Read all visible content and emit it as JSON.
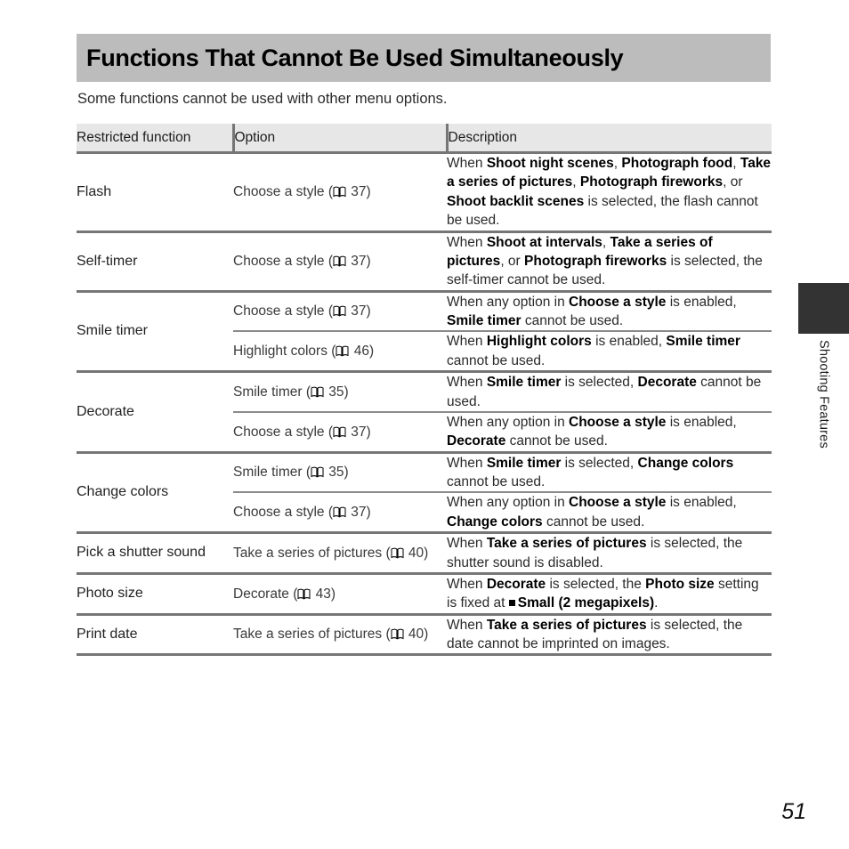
{
  "page": {
    "title": "Functions That Cannot Be Used Simultaneously",
    "intro": "Some functions cannot be used with other menu options.",
    "page_number": "51",
    "side_tab_label": "Shooting Features",
    "colors": {
      "title_bar_bg": "#bcbcbc",
      "header_row_bg": "#e7e7e7",
      "border": "#767676",
      "side_tab_bg": "#333333",
      "text": "#2a2a2a"
    }
  },
  "table": {
    "headers": [
      "Restricted function",
      "Option",
      "Description"
    ],
    "rows": [
      {
        "function": "Flash",
        "entries": [
          {
            "option_text": "Choose a style (",
            "option_icon": "book-icon",
            "option_page": "37)",
            "description_runs": [
              {
                "t": "When ",
                "b": false
              },
              {
                "t": "Shoot night scenes",
                "b": true
              },
              {
                "t": ", ",
                "b": false
              },
              {
                "t": "Photograph food",
                "b": true
              },
              {
                "t": ", ",
                "b": false
              },
              {
                "t": "Take a series of pictures",
                "b": true
              },
              {
                "t": ", ",
                "b": false
              },
              {
                "t": "Photograph fireworks",
                "b": true
              },
              {
                "t": ", or ",
                "b": false
              },
              {
                "t": "Shoot backlit scenes",
                "b": true
              },
              {
                "t": " is selected, the flash cannot be used.",
                "b": false
              }
            ]
          }
        ]
      },
      {
        "function": "Self-timer",
        "entries": [
          {
            "option_text": "Choose a style (",
            "option_icon": "book-icon",
            "option_page": "37)",
            "description_runs": [
              {
                "t": "When ",
                "b": false
              },
              {
                "t": "Shoot at intervals",
                "b": true
              },
              {
                "t": ", ",
                "b": false
              },
              {
                "t": "Take a series of pictures",
                "b": true
              },
              {
                "t": ", or ",
                "b": false
              },
              {
                "t": "Photograph fireworks",
                "b": true
              },
              {
                "t": " is selected, the self-timer cannot be used.",
                "b": false
              }
            ]
          }
        ]
      },
      {
        "function": "Smile timer",
        "entries": [
          {
            "option_text": "Choose a style (",
            "option_icon": "book-icon",
            "option_page": "37)",
            "description_runs": [
              {
                "t": "When any option in ",
                "b": false
              },
              {
                "t": "Choose a style",
                "b": true
              },
              {
                "t": " is enabled, ",
                "b": false
              },
              {
                "t": "Smile timer",
                "b": true
              },
              {
                "t": " cannot be used.",
                "b": false
              }
            ]
          },
          {
            "option_text": "Highlight colors (",
            "option_icon": "book-icon",
            "option_page": "46)",
            "description_runs": [
              {
                "t": "When ",
                "b": false
              },
              {
                "t": "Highlight colors",
                "b": true
              },
              {
                "t": " is enabled, ",
                "b": false
              },
              {
                "t": "Smile timer",
                "b": true
              },
              {
                "t": " cannot be used.",
                "b": false
              }
            ]
          }
        ]
      },
      {
        "function": "Decorate",
        "entries": [
          {
            "option_text": "Smile timer (",
            "option_icon": "book-icon",
            "option_page": "35)",
            "description_runs": [
              {
                "t": "When ",
                "b": false
              },
              {
                "t": "Smile timer",
                "b": true
              },
              {
                "t": " is selected, ",
                "b": false
              },
              {
                "t": "Decorate",
                "b": true
              },
              {
                "t": " cannot be used.",
                "b": false
              }
            ]
          },
          {
            "option_text": "Choose a style (",
            "option_icon": "book-icon",
            "option_page": "37)",
            "description_runs": [
              {
                "t": "When any option in ",
                "b": false
              },
              {
                "t": "Choose a style",
                "b": true
              },
              {
                "t": " is enabled, ",
                "b": false
              },
              {
                "t": "Decorate",
                "b": true
              },
              {
                "t": " cannot be used.",
                "b": false
              }
            ]
          }
        ]
      },
      {
        "function": "Change colors",
        "entries": [
          {
            "option_text": "Smile timer (",
            "option_icon": "book-icon",
            "option_page": "35)",
            "description_runs": [
              {
                "t": "When ",
                "b": false
              },
              {
                "t": "Smile timer",
                "b": true
              },
              {
                "t": " is selected, ",
                "b": false
              },
              {
                "t": "Change colors",
                "b": true
              },
              {
                "t": " cannot be used.",
                "b": false
              }
            ]
          },
          {
            "option_text": "Choose a style (",
            "option_icon": "book-icon",
            "option_page": "37)",
            "description_runs": [
              {
                "t": "When any option in ",
                "b": false
              },
              {
                "t": "Choose a style",
                "b": true
              },
              {
                "t": " is enabled, ",
                "b": false
              },
              {
                "t": "Change colors",
                "b": true
              },
              {
                "t": " cannot be used.",
                "b": false
              }
            ]
          }
        ]
      },
      {
        "function": "Pick a shutter sound",
        "entries": [
          {
            "option_text": "Take a series of pictures (",
            "option_icon": "book-icon",
            "option_page": "40)",
            "description_runs": [
              {
                "t": "When ",
                "b": false
              },
              {
                "t": "Take a series of pictures",
                "b": true
              },
              {
                "t": " is selected, the shutter sound is disabled.",
                "b": false
              }
            ]
          }
        ]
      },
      {
        "function": "Photo size",
        "entries": [
          {
            "option_text": "Decorate (",
            "option_icon": "book-icon",
            "option_page": "43)",
            "description_runs": [
              {
                "t": "When ",
                "b": false
              },
              {
                "t": "Decorate",
                "b": true
              },
              {
                "t": " is selected, the ",
                "b": false
              },
              {
                "t": "Photo size",
                "b": true
              },
              {
                "t": " setting is fixed at ",
                "b": false
              },
              {
                "t": "SQUARE_ICON",
                "b": false,
                "icon": "small-square-icon"
              },
              {
                "t": "Small (2 megapixels)",
                "b": true
              },
              {
                "t": ".",
                "b": false
              }
            ]
          }
        ]
      },
      {
        "function": "Print date",
        "entries": [
          {
            "option_text": "Take a series of pictures (",
            "option_icon": "book-icon",
            "option_page": "40)",
            "description_runs": [
              {
                "t": "When ",
                "b": false
              },
              {
                "t": "Take a series of pictures",
                "b": true
              },
              {
                "t": " is selected, the date cannot be imprinted on images.",
                "b": false
              }
            ]
          }
        ]
      }
    ]
  }
}
